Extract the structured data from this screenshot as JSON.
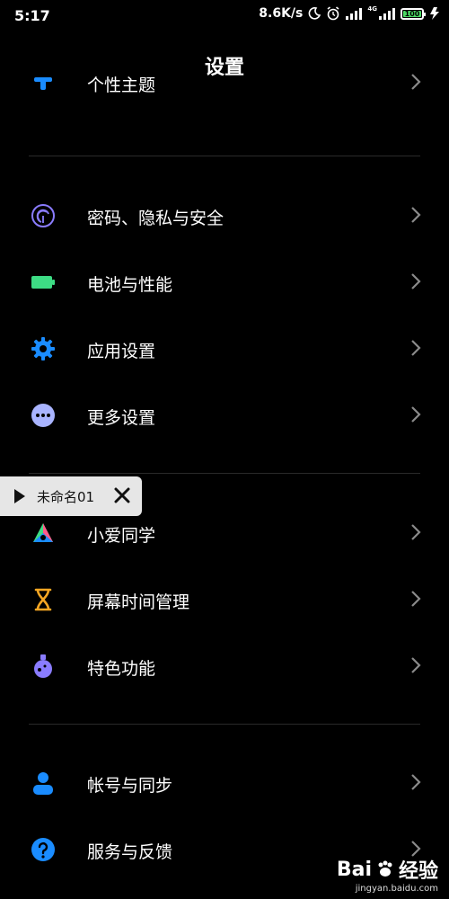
{
  "status_bar": {
    "time": "5:17",
    "speed": "8.6K/s",
    "network": "4G",
    "battery": "100"
  },
  "header": {
    "title": "设置"
  },
  "items": [
    {
      "label": "个性主题",
      "icon": "theme-icon"
    },
    {
      "label": "密码、隐私与安全",
      "icon": "fingerprint-icon"
    },
    {
      "label": "电池与性能",
      "icon": "battery-icon"
    },
    {
      "label": "应用设置",
      "icon": "gear-icon"
    },
    {
      "label": "更多设置",
      "icon": "more-icon"
    },
    {
      "label": "小爱同学",
      "icon": "xiaoai-icon"
    },
    {
      "label": "屏幕时间管理",
      "icon": "hourglass-icon"
    },
    {
      "label": "特色功能",
      "icon": "flask-icon"
    },
    {
      "label": "帐号与同步",
      "icon": "user-icon"
    },
    {
      "label": "服务与反馈",
      "icon": "help-icon"
    }
  ],
  "recorder": {
    "name": "未命名01"
  },
  "watermark": {
    "brand": "Bai",
    "brand_suffix": "经验",
    "url": "jingyan.baidu.com"
  },
  "colors": {
    "background": "#000000",
    "purple": "#7b7bff",
    "green": "#3ddc84",
    "blue": "#1a8cff"
  }
}
